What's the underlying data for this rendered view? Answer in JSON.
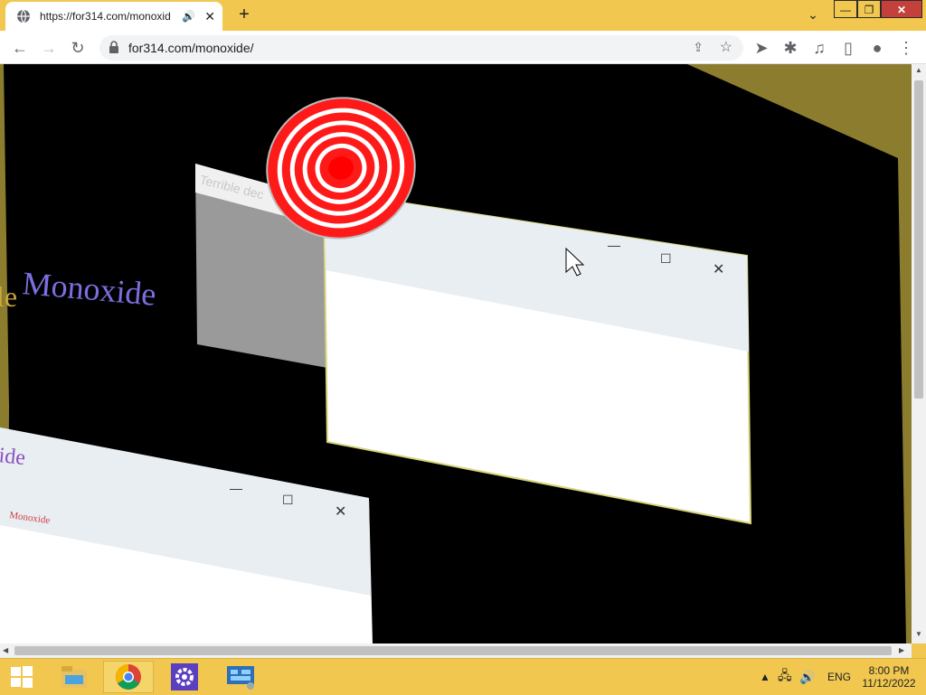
{
  "browser": {
    "tab": {
      "title": "https://for314.com/monoxid",
      "audio_icon": "speaker-icon",
      "close_label": "✕"
    },
    "new_tab_label": "+",
    "window_controls": {
      "minimize": "—",
      "maximize": "❐",
      "close": "✕"
    },
    "address": {
      "url": "for314.com/monoxide/",
      "secure": true
    }
  },
  "page": {
    "background_text_1": "Monoxide",
    "background_text_fragment": "le",
    "background_text_2": "ide",
    "small_label": "Monoxide",
    "ghost_title": "Terrible dec",
    "window_buttons": {
      "minimize": "—",
      "maximize": "☐",
      "close": "✕"
    },
    "accent_red": "#ff1a1a",
    "text_purple": "#7b6fe0"
  },
  "taskbar": {
    "apps": [
      "file-explorer-icon",
      "chrome-icon",
      "settings-icon",
      "control-panel-icon"
    ],
    "language": "ENG",
    "time": "8:00 PM",
    "date": "11/12/2022"
  }
}
